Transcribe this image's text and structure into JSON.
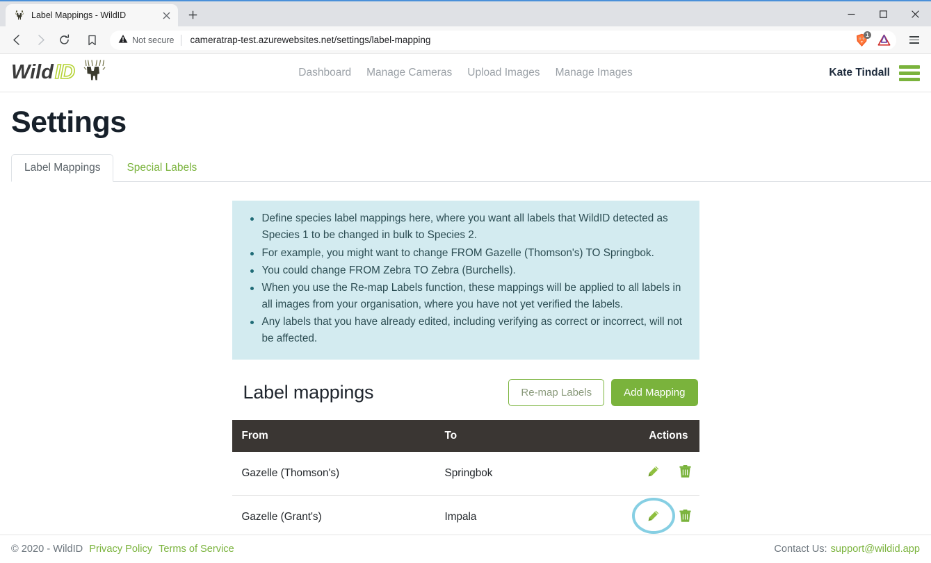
{
  "browser": {
    "tab": {
      "title": "Label Mappings - WildID",
      "favicon_icon": "wildid-antelope-favicon",
      "close_icon": "close-icon"
    },
    "new_tab_icon": "plus-icon",
    "window_controls": {
      "minimize_icon": "minimize-icon",
      "maximize_icon": "maximize-icon",
      "close_icon": "close-icon"
    },
    "toolbar": {
      "back_icon": "back-arrow-icon",
      "forward_icon": "forward-arrow-icon",
      "reload_icon": "reload-icon",
      "bookmark_icon": "bookmark-icon",
      "security_warning_icon": "warning-triangle-icon",
      "security_label": "Not secure",
      "url": "cameratrap-test.azurewebsites.net/settings/label-mapping",
      "extensions": [
        {
          "name": "brave-shields-icon",
          "badge": "1"
        },
        {
          "name": "purple-triangle-extension-icon",
          "badge": ""
        }
      ],
      "menu_icon": "hamburger-menu-icon"
    }
  },
  "site_header": {
    "logo": {
      "name": "wildid-logo",
      "text_dark": "Wild",
      "text_outline": "ID"
    },
    "nav": [
      {
        "label": "Dashboard"
      },
      {
        "label": "Manage Cameras"
      },
      {
        "label": "Upload Images"
      },
      {
        "label": "Manage Images"
      }
    ],
    "user_name": "Kate Tindall",
    "menu_icon": "hamburger-menu-icon"
  },
  "page": {
    "title": "Settings",
    "tabs": [
      {
        "label": "Label Mappings",
        "active": true
      },
      {
        "label": "Special Labels",
        "active": false
      }
    ],
    "info_bullets": [
      "Define species label mappings here, where you want all labels that WildID detected as Species 1 to be changed in bulk to Species 2.",
      "For example, you might want to change FROM Gazelle (Thomson's) TO Springbok.",
      "You could change FROM Zebra TO Zebra (Burchells).",
      "When you use the Re-map Labels function, these mappings will be applied to all labels in all images from your organisation, where you have not yet verified the labels.",
      "Any labels that you have already edited, including verifying as correct or incorrect, will not be affected."
    ],
    "section": {
      "title": "Label mappings",
      "remap_button": "Re-map Labels",
      "add_button": "Add Mapping"
    },
    "table": {
      "headers": [
        "From",
        "To",
        "Actions"
      ],
      "rows": [
        {
          "from": "Gazelle (Thomson's)",
          "to": "Springbok",
          "edit_icon": "pencil-edit-icon",
          "delete_icon": "trash-delete-icon",
          "highlighted": false
        },
        {
          "from": "Gazelle (Grant's)",
          "to": "Impala",
          "edit_icon": "pencil-edit-icon",
          "delete_icon": "trash-delete-icon",
          "highlighted": true
        }
      ]
    }
  },
  "footer": {
    "copyright": "© 2020 - WildID",
    "privacy_link": "Privacy Policy",
    "terms_link": "Terms of Service",
    "contact_label": "Contact Us:",
    "contact_email": "support@wildid.app"
  },
  "colors": {
    "brand_green": "#7ab33c",
    "info_bg": "#d3ebf0",
    "table_header_bg": "#3a3633",
    "highlight_ring": "#86cfe3"
  }
}
